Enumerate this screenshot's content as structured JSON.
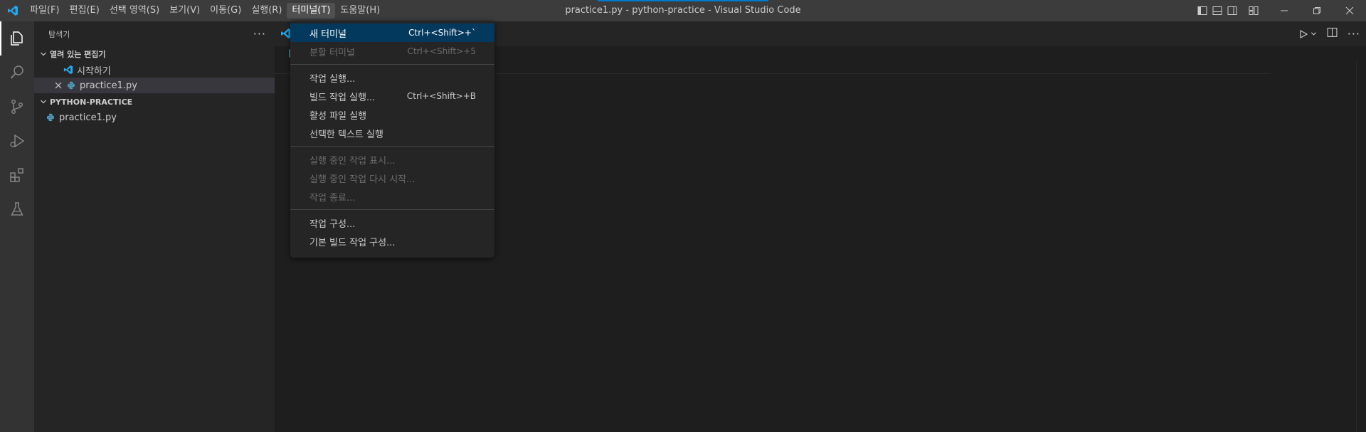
{
  "window": {
    "title": "practice1.py - python-practice - Visual Studio Code"
  },
  "menubar": [
    {
      "label": "파일(F)",
      "active": false
    },
    {
      "label": "편집(E)",
      "active": false
    },
    {
      "label": "선택 영역(S)",
      "active": false
    },
    {
      "label": "보기(V)",
      "active": false
    },
    {
      "label": "이동(G)",
      "active": false
    },
    {
      "label": "실행(R)",
      "active": false
    },
    {
      "label": "터미널(T)",
      "active": true
    },
    {
      "label": "도움말(H)",
      "active": false
    }
  ],
  "sidebar": {
    "title": "탐색기",
    "open_editors": {
      "header": "열려 있는 편집기",
      "items": [
        {
          "label": "시작하기"
        },
        {
          "label": "practice1.py"
        }
      ]
    },
    "workspace": {
      "header": "PYTHON-PRACTICE",
      "items": [
        {
          "label": "practice1.py"
        }
      ]
    }
  },
  "terminal_menu": {
    "group1": [
      {
        "label": "새 터미널",
        "shortcut": "Ctrl+<Shift>+`",
        "state": "highlight"
      },
      {
        "label": "분할 터미널",
        "shortcut": "Ctrl+<Shift>+5",
        "state": "disabled"
      }
    ],
    "group2": [
      {
        "label": "작업 실행...",
        "shortcut": ""
      },
      {
        "label": "빌드 작업 실행...",
        "shortcut": "Ctrl+<Shift>+B"
      },
      {
        "label": "활성 파일 실행",
        "shortcut": ""
      },
      {
        "label": "선택한 텍스트 실행",
        "shortcut": ""
      }
    ],
    "group3": [
      {
        "label": "실행 중인 작업 표시...",
        "shortcut": ""
      },
      {
        "label": "실행 중인 작업 다시 시작...",
        "shortcut": ""
      },
      {
        "label": "작업 종료...",
        "shortcut": ""
      }
    ],
    "group4": [
      {
        "label": "작업 구성...",
        "shortcut": ""
      },
      {
        "label": "기본 빌드 작업 구성...",
        "shortcut": ""
      }
    ]
  },
  "colors": {
    "accent": "#007acc",
    "vscode_blue": "#23a9f2",
    "python_blue": "#519aba",
    "menu_highlight": "#04395e"
  },
  "icons": {
    "activity": [
      "explorer-icon",
      "search-icon",
      "source-control-icon",
      "run-debug-icon",
      "extensions-icon",
      "testing-icon"
    ]
  }
}
